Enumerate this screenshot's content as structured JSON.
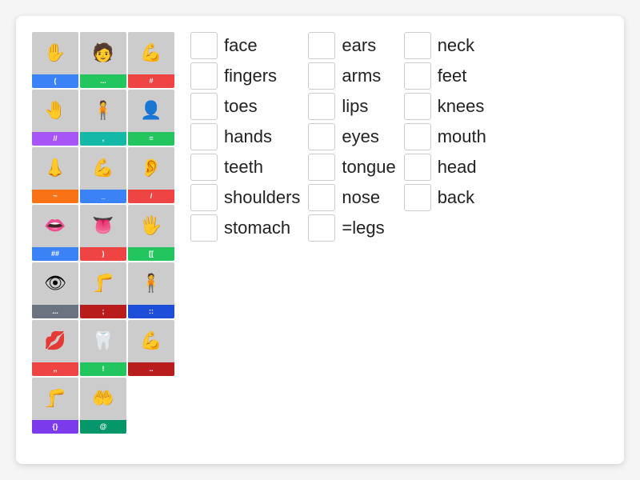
{
  "grid_cells": [
    {
      "label": "(",
      "bar_class": "bar-blue",
      "emoji": "✋",
      "img_class": "img-skin"
    },
    {
      "label": "...",
      "bar_class": "bar-green",
      "emoji": "🧑",
      "img_class": "img-skin"
    },
    {
      "label": "#",
      "bar_class": "bar-red",
      "emoji": "💪",
      "img_class": "img-skin"
    },
    {
      "label": "//",
      "bar_class": "bar-purple",
      "emoji": "🤚",
      "img_class": "img-skin"
    },
    {
      "label": ",",
      "bar_class": "bar-teal",
      "emoji": "🧍",
      "img_class": "img-skin"
    },
    {
      "label": "=",
      "bar_class": "bar-green",
      "emoji": "👤",
      "img_class": "img-dark"
    },
    {
      "label": "~",
      "bar_class": "bar-orange",
      "emoji": "👃",
      "img_class": "img-skin"
    },
    {
      "label": "_",
      "bar_class": "bar-blue",
      "emoji": "💪",
      "img_class": "img-skin"
    },
    {
      "label": "/",
      "bar_class": "bar-red",
      "emoji": "👂",
      "img_class": "img-skin"
    },
    {
      "label": "##",
      "bar_class": "bar-blue",
      "emoji": "👄",
      "img_class": "img-skin"
    },
    {
      "label": ")",
      "bar_class": "bar-red",
      "emoji": "👅",
      "img_class": "img-skin"
    },
    {
      "label": "[[",
      "bar_class": "bar-green",
      "emoji": "🖐",
      "img_class": "img-skin"
    },
    {
      "label": "...",
      "bar_class": "bar-gray",
      "emoji": "👁",
      "img_class": "img-skin"
    },
    {
      "label": ";",
      "bar_class": "bar-darkred",
      "emoji": "🦵",
      "img_class": "img-skin"
    },
    {
      "label": "::",
      "bar_class": "bar-darkblue",
      "emoji": "🧍",
      "img_class": "img-dark"
    },
    {
      "label": ",,",
      "bar_class": "bar-red",
      "emoji": "💋",
      "img_class": "img-skin"
    },
    {
      "label": "!",
      "bar_class": "bar-green",
      "emoji": "🦷",
      "img_class": "img-white"
    },
    {
      "label": "..",
      "bar_class": "bar-darkred",
      "emoji": "💪",
      "img_class": "img-mixed"
    },
    {
      "label": "{}",
      "bar_class": "bar-violet",
      "emoji": "🦵",
      "img_class": "img-skin"
    },
    {
      "label": "@",
      "bar_class": "bar-emerald",
      "emoji": "🤲",
      "img_class": "img-skin"
    }
  ],
  "word_columns": [
    {
      "items": [
        {
          "label": "face"
        },
        {
          "label": "fingers"
        },
        {
          "label": "toes"
        },
        {
          "label": "hands"
        },
        {
          "label": "teeth"
        },
        {
          "label": "shoulders"
        },
        {
          "label": "stomach"
        }
      ]
    },
    {
      "items": [
        {
          "label": "ears"
        },
        {
          "label": "arms"
        },
        {
          "label": "lips"
        },
        {
          "label": "eyes"
        },
        {
          "label": "tongue"
        },
        {
          "label": "nose"
        },
        {
          "label": "=legs"
        }
      ]
    },
    {
      "items": [
        {
          "label": "neck"
        },
        {
          "label": "feet"
        },
        {
          "label": "knees"
        },
        {
          "label": "mouth"
        },
        {
          "label": "head"
        },
        {
          "label": "back"
        }
      ]
    }
  ]
}
